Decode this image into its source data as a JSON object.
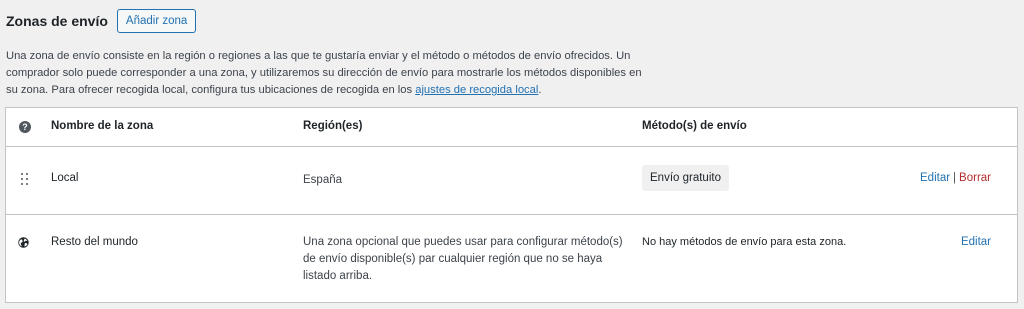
{
  "header": {
    "title": "Zonas de envío",
    "add_zone_label": "Añadir zona"
  },
  "description": {
    "text": "Una zona de envío consiste en la región o regiones a las que te gustaría enviar y el método o métodos de envío ofrecidos. Un comprador solo puede corresponder a una zona, y utilizaremos su dirección de envío para mostrarle los métodos disponibles en su zona. Para ofrecer recogida local, configura tus ubicaciones de recogida en los ",
    "link_label": "ajustes de recogida local",
    "end": "."
  },
  "table": {
    "columns": {
      "name": "Nombre de la zona",
      "region": "Región(es)",
      "methods": "Método(s) de envío"
    },
    "help_icon": "help-icon",
    "rows": [
      {
        "icon": "drag-handle-icon",
        "name": "Local",
        "region": "España",
        "method": "Envío gratuito",
        "edit_label": "Editar",
        "separator": "|",
        "delete_label": "Borrar"
      },
      {
        "icon": "globe-icon",
        "name": "Resto del mundo",
        "region": "Una zona opcional que puedes usar para configurar método(s) de envío disponible(s) par cualquier región que no se haya listado arriba.",
        "no_methods": "No hay métodos de envío para esta zona.",
        "edit_label": "Editar"
      }
    ]
  },
  "colors": {
    "accent": "#2271b1",
    "delete": "#b32d2e",
    "background": "#f0f0f1",
    "border": "#c3c4c7"
  }
}
